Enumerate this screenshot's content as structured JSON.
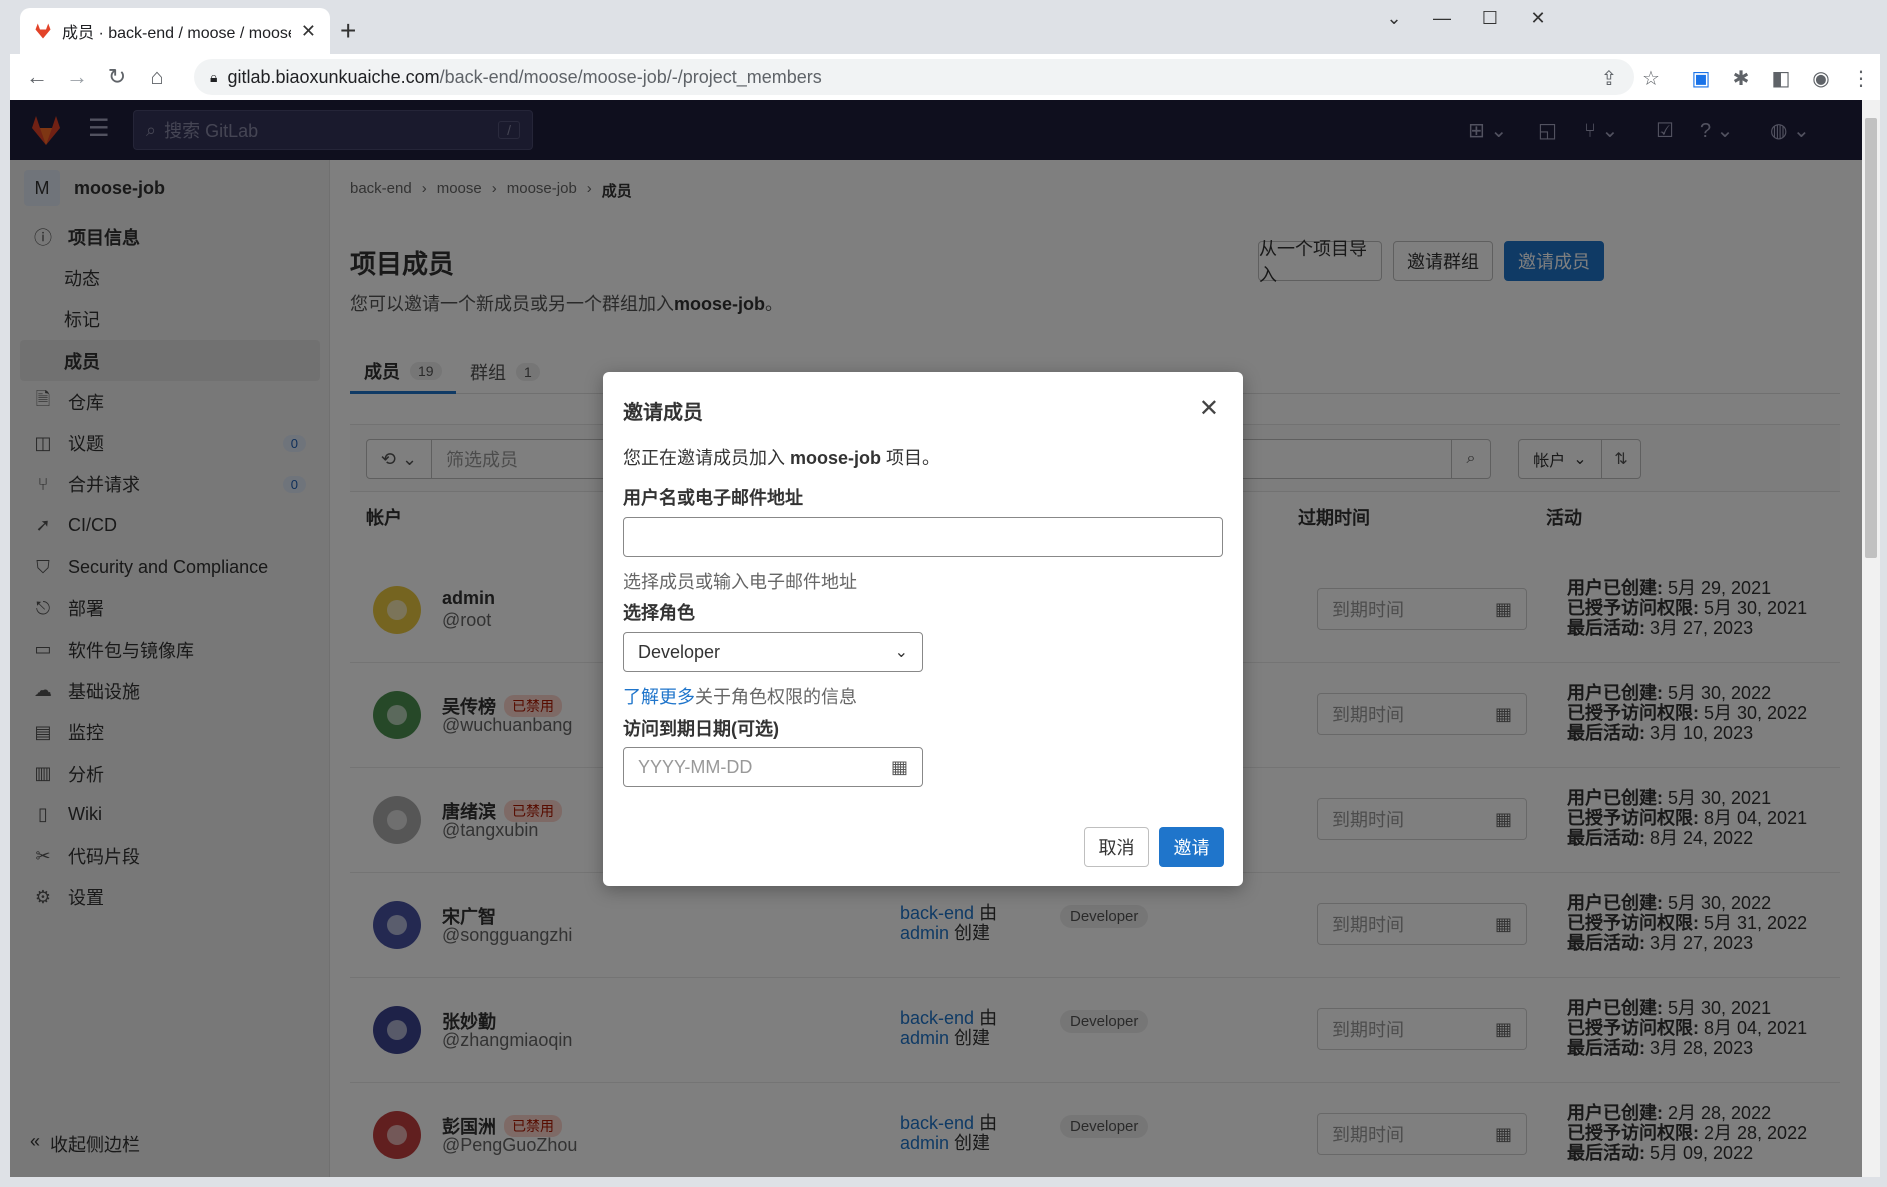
{
  "browser": {
    "tab_title": "成员 · back-end / moose / moose-job",
    "url_host": "gitlab.biaoxunkuaiche.com",
    "url_path": "/back-end/moose/moose-job/-/project_members"
  },
  "header": {
    "search_placeholder": "搜索 GitLab",
    "search_shortcut": "/"
  },
  "sidebar": {
    "project_initial": "M",
    "project_name": "moose-job",
    "items": [
      {
        "label": "项目信息",
        "icon": "info-icon",
        "bold": true
      },
      {
        "label": "动态",
        "sub": true
      },
      {
        "label": "标记",
        "sub": true
      },
      {
        "label": "成员",
        "sub": true,
        "active": true
      },
      {
        "label": "仓库",
        "icon": "repo-icon"
      },
      {
        "label": "议题",
        "icon": "issues-icon",
        "badge": "0"
      },
      {
        "label": "合并请求",
        "icon": "merge-request-icon",
        "badge": "0"
      },
      {
        "label": "CI/CD",
        "icon": "rocket-icon"
      },
      {
        "label": "Security and Compliance",
        "icon": "shield-icon"
      },
      {
        "label": "部署",
        "icon": "deploy-icon"
      },
      {
        "label": "软件包与镜像库",
        "icon": "package-icon"
      },
      {
        "label": "基础设施",
        "icon": "cloud-icon"
      },
      {
        "label": "监控",
        "icon": "monitor-icon"
      },
      {
        "label": "分析",
        "icon": "chart-icon"
      },
      {
        "label": "Wiki",
        "icon": "book-icon"
      },
      {
        "label": "代码片段",
        "icon": "snippet-icon"
      },
      {
        "label": "设置",
        "icon": "gear-icon"
      }
    ],
    "collapse_label": "收起侧边栏"
  },
  "main": {
    "breadcrumb": [
      "back-end",
      "moose",
      "moose-job",
      "成员"
    ],
    "title": "项目成员",
    "desc_prefix": "您可以邀请一个新成员或另一个群组加入",
    "desc_project": "moose-job",
    "desc_suffix": "。",
    "buttons": {
      "import": "从一个项目导入",
      "invite_group": "邀请群组",
      "invite_member": "邀请成员"
    },
    "tabs": [
      {
        "label": "成员",
        "count": "19"
      },
      {
        "label": "群组",
        "count": "1"
      }
    ],
    "filter_placeholder": "筛选成员",
    "sort_label": "帐户",
    "columns": {
      "account": "帐户",
      "expires": "过期时间",
      "activity": "活动"
    },
    "members": [
      {
        "name": "admin",
        "handle": "@root",
        "blocked": "",
        "source_group": "",
        "source_by": "",
        "source_user": "",
        "source_created": "",
        "role": "",
        "expire_placeholder": "到期时间",
        "created": "5月 29, 2021",
        "granted": "5月 30, 2021",
        "last": "3月 27, 2023"
      },
      {
        "name": "吴传榜",
        "handle": "@wuchuanbang",
        "blocked": "已禁用",
        "source_group": "",
        "source_by": "",
        "source_user": "",
        "source_created": "",
        "role": "",
        "expire_placeholder": "到期时间",
        "created": "5月 30, 2022",
        "granted": "5月 30, 2022",
        "last": "3月 10, 2023"
      },
      {
        "name": "唐绪滨",
        "handle": "@tangxubin",
        "blocked": "已禁用",
        "source_group": "",
        "source_by": "",
        "source_user": "",
        "source_created": "",
        "role": "",
        "expire_placeholder": "到期时间",
        "created": "5月 30, 2021",
        "granted": "8月 04, 2021",
        "last": "8月 24, 2022"
      },
      {
        "name": "宋广智",
        "handle": "@songguangzhi",
        "blocked": "",
        "source_group": "back-end",
        "source_by": " 由",
        "source_user": "admin",
        "source_created": " 创建",
        "role": "Developer",
        "expire_placeholder": "到期时间",
        "created": "5月 30, 2022",
        "granted": "5月 31, 2022",
        "last": "3月 27, 2023"
      },
      {
        "name": "张妙勤",
        "handle": "@zhangmiaoqin",
        "blocked": "",
        "source_group": "back-end",
        "source_by": " 由",
        "source_user": "admin",
        "source_created": " 创建",
        "role": "Developer",
        "expire_placeholder": "到期时间",
        "created": "5月 30, 2021",
        "granted": "8月 04, 2021",
        "last": "3月 28, 2023"
      },
      {
        "name": "彭国洲",
        "handle": "@PengGuoZhou",
        "blocked": "已禁用",
        "source_group": "back-end",
        "source_by": " 由",
        "source_user": "admin",
        "source_created": " 创建",
        "role": "Developer",
        "expire_placeholder": "到期时间",
        "created": "2月 28, 2022",
        "granted": "2月 28, 2022",
        "last": "5月 09, 2022"
      }
    ],
    "activity_labels": {
      "created": "用户已创建:",
      "granted": "已授予访问权限:",
      "last": "最后活动:"
    }
  },
  "modal": {
    "title": "邀请成员",
    "intro_prefix": "您正在邀请成员加入 ",
    "intro_project": "moose-job",
    "intro_suffix": " 项目。",
    "username_label": "用户名或电子邮件地址",
    "username_value": "",
    "username_help": "选择成员或输入电子邮件地址",
    "role_label": "选择角色",
    "role_value": "Developer",
    "role_help_link": "了解更多",
    "role_help_text": "关于角色权限的信息",
    "date_label": "访问到期日期(可选)",
    "date_placeholder": "YYYY-MM-DD",
    "cancel": "取消",
    "invite": "邀请"
  },
  "colors": {
    "primary": "#1f75cb",
    "header": "#1f1f3d",
    "blocked_bg": "#fdd4cd",
    "blocked_fg": "#ae1800"
  }
}
